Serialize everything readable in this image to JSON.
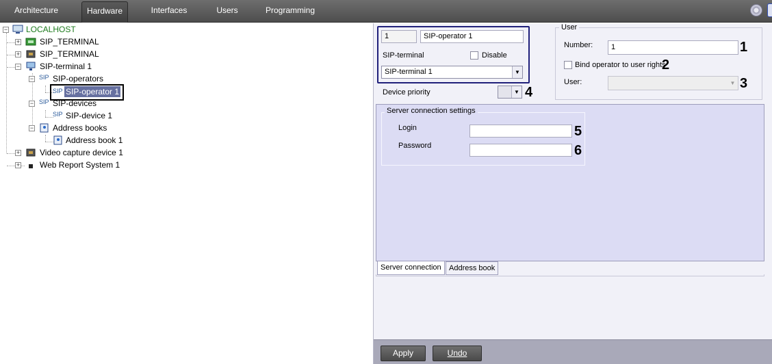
{
  "top_tabs": [
    "Architecture",
    "Hardware",
    "Interfaces",
    "Users",
    "Programming"
  ],
  "active_tab": "Hardware",
  "tree": {
    "root": "LOCALHOST",
    "items": [
      "SIP_TERMINAL",
      "SIP_TERMINAL",
      "SIP-terminal 1",
      "SIP-operators",
      "SIP-operator 1",
      "SIP-devices",
      "SIP-device 1",
      "Address books",
      "Address book 1",
      "Video capture device 1",
      "Web Report System 1"
    ],
    "icon_text": "SIP"
  },
  "object": {
    "id": "1",
    "name": "SIP-operator 1",
    "sip_terminal_label": "SIP-terminal",
    "disable_label": "Disable",
    "sip_terminal_value": "SIP-terminal 1",
    "device_priority_label": "Device priority",
    "device_priority_value": ""
  },
  "user_group": {
    "title": "User",
    "number_label": "Number:",
    "number_value": "1",
    "bind_label": "Bind operator to user rights",
    "user_label": "User:",
    "user_value": ""
  },
  "server_group": {
    "title": "Server connection settings",
    "login_label": "Login",
    "login_value": "",
    "password_label": "Password",
    "password_value": ""
  },
  "subtabs": [
    "Server connection",
    "Address book"
  ],
  "annotations": [
    "1",
    "2",
    "3",
    "4",
    "5",
    "6"
  ],
  "buttons": {
    "apply": "Apply",
    "undo": "Undo"
  },
  "colors": {
    "topbar": "#5e5e5e",
    "panel": "#f1f1f8",
    "tab_pane": "#dcdcf4",
    "selection": "#6670a0",
    "tree_root": "#1d7b1d"
  }
}
